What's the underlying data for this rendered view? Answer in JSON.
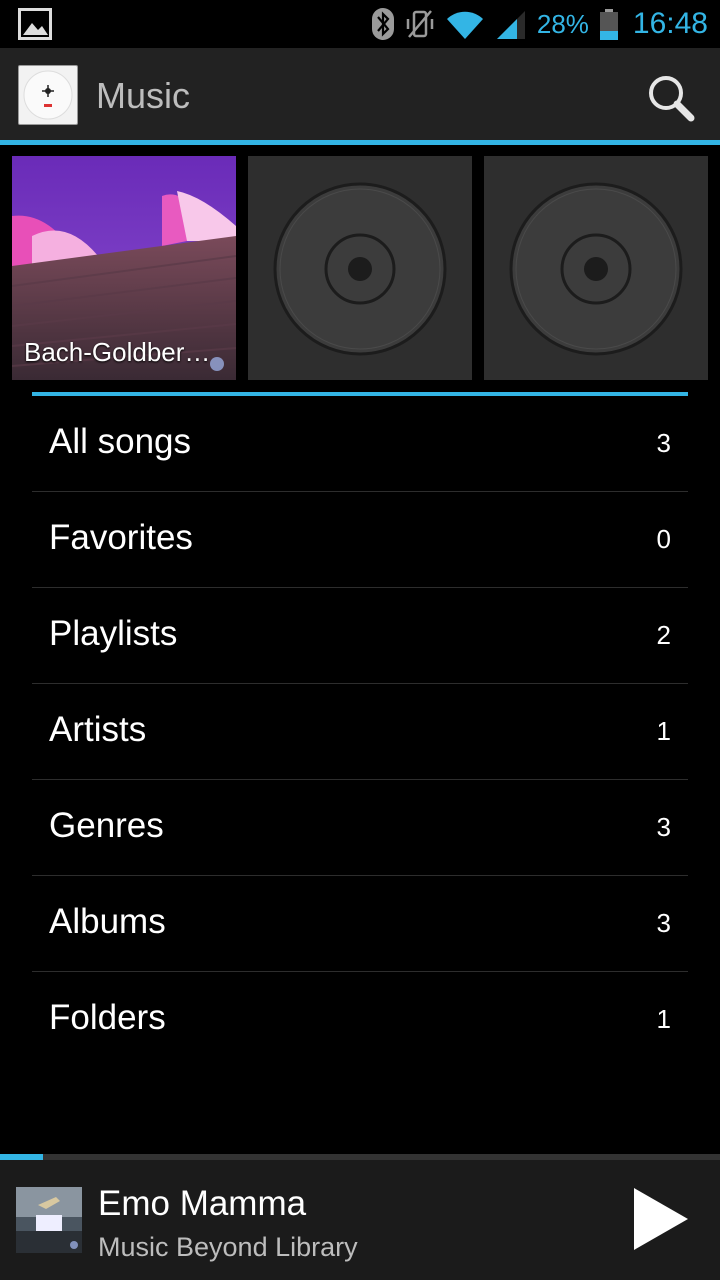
{
  "status_bar": {
    "battery_text": "28%",
    "time": "16:48",
    "icons": [
      "gallery-icon",
      "bluetooth-icon",
      "vibrate-off-icon",
      "wifi-icon",
      "signal-icon",
      "battery-icon"
    ]
  },
  "action_bar": {
    "title": "Music",
    "icons": [
      "music-app-icon",
      "search-icon"
    ]
  },
  "recent_tiles": [
    {
      "label": "Bach-Goldber…",
      "art": "opera-house"
    },
    {
      "label": "",
      "art": "default-disc"
    },
    {
      "label": "",
      "art": "default-disc"
    }
  ],
  "library": {
    "items": [
      {
        "label": "All songs",
        "count": "3"
      },
      {
        "label": "Favorites",
        "count": "0"
      },
      {
        "label": "Playlists",
        "count": "2"
      },
      {
        "label": "Artists",
        "count": "1"
      },
      {
        "label": "Genres",
        "count": "3"
      },
      {
        "label": "Albums",
        "count": "3"
      },
      {
        "label": "Folders",
        "count": "1"
      }
    ]
  },
  "now_playing": {
    "title": "Emo Mamma",
    "subtitle": "Music Beyond Library",
    "progress": 0.06,
    "icons": [
      "album-art-thumb",
      "play-icon"
    ]
  },
  "colors": {
    "accent": "#33b5e5",
    "action_bar": "#222222",
    "background": "#000000",
    "divider": "#2d2d2d"
  }
}
